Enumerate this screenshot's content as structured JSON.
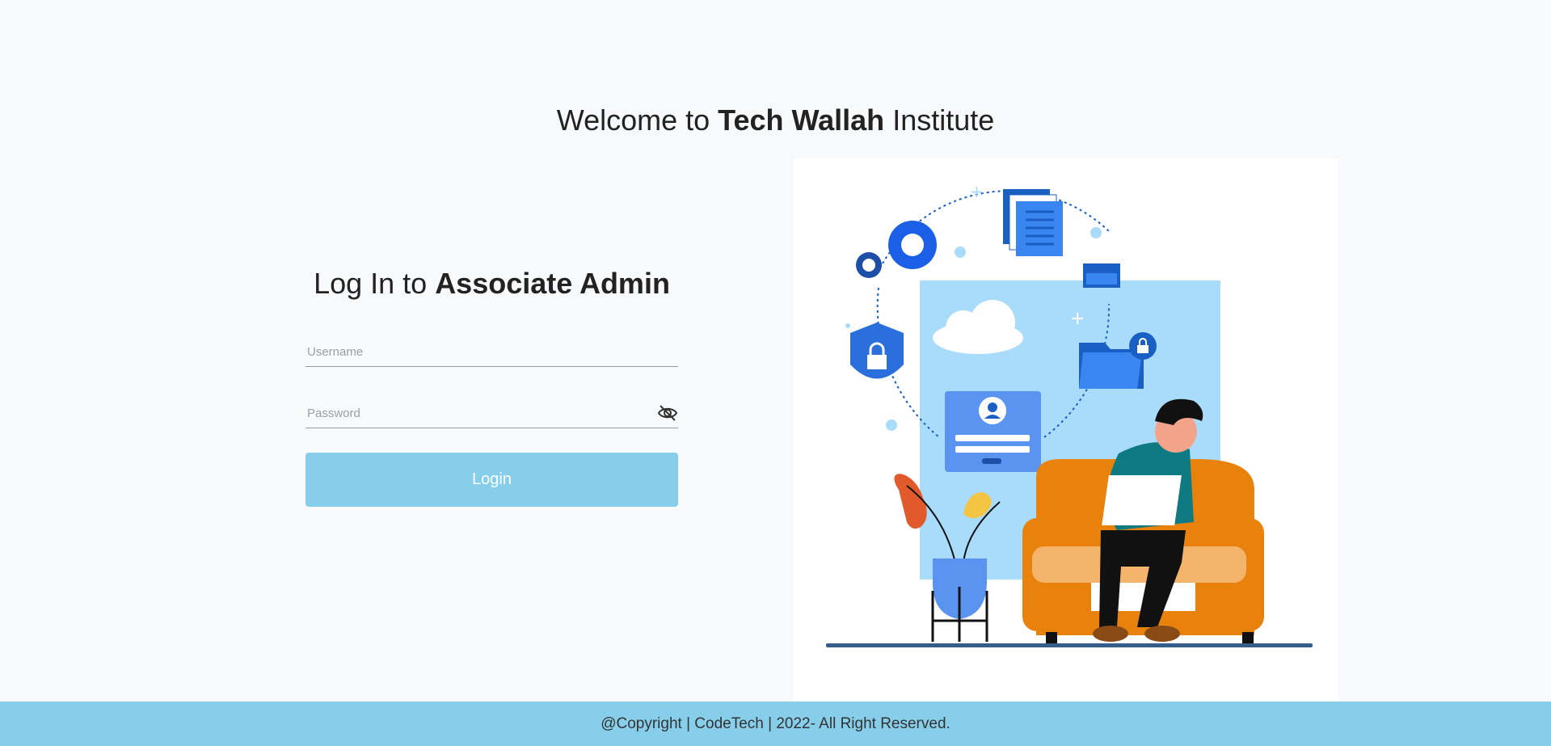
{
  "header": {
    "welcome_prefix": "Welcome to ",
    "welcome_brand": "Tech Wallah",
    "welcome_suffix": " Institute"
  },
  "login": {
    "title_prefix": "Log In to ",
    "title_bold": "Associate Admin",
    "username_placeholder": "Username",
    "password_placeholder": "Password",
    "login_label": "Login",
    "eye_icon": "eye-slash-icon"
  },
  "footer": {
    "copyright": "@Copyright | CodeTech | 2022- All Right Reserved."
  },
  "colors": {
    "accent": "#87ceeb",
    "background": "#f8f9fb"
  }
}
